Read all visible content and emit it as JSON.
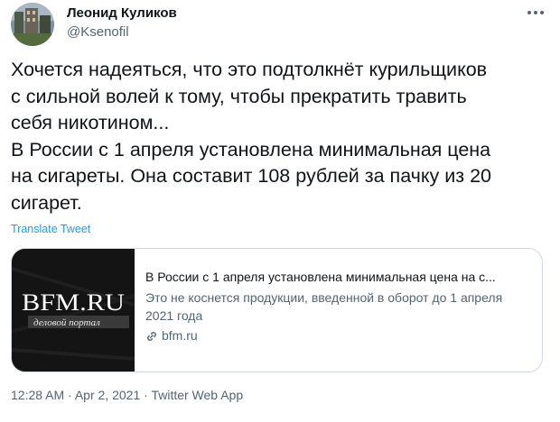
{
  "author": {
    "name": "Леонид Куликов",
    "handle": "@Ksenofil"
  },
  "tweet": {
    "lines": [
      "Хочется надеяться, что это подтолкнёт курильщиков",
      "с сильной волей к тому, чтобы прекратить травить",
      "себя никотином...",
      "В России с 1 апреля установлена минимальная цена",
      "на сигареты. Она составит 108 рублей за пачку из 20",
      "сигарет."
    ],
    "translate_label": "Translate Tweet"
  },
  "card": {
    "thumb_logo": "BFM.RU",
    "thumb_subtitle": "деловой портал",
    "title": "В России с 1 апреля установлена минимальная цена на с...",
    "description": "Это не коснется продукции, введенной в оборот до 1 апреля 2021 года",
    "domain": "bfm.ru"
  },
  "footer": {
    "time": "12:28 AM",
    "date": "Apr 2, 2021",
    "source": "Twitter Web App",
    "separator": "·"
  },
  "icons": {
    "more": "more-icon",
    "link": "link-icon"
  },
  "colors": {
    "accent": "#1d9bf0",
    "secondary_text": "#536471",
    "primary_text": "#0f1419",
    "border": "#cfd9de"
  }
}
